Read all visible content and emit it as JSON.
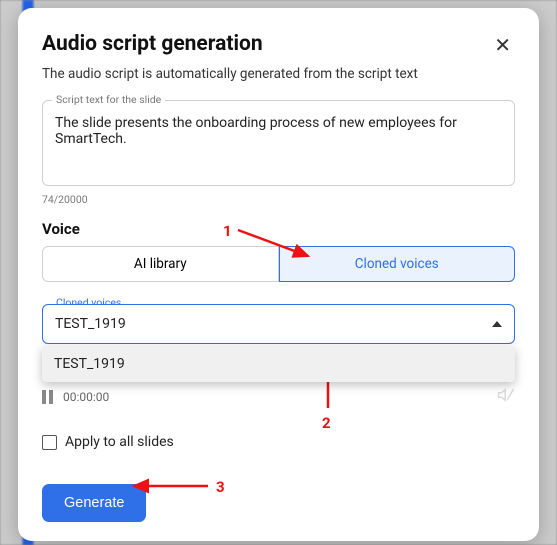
{
  "modal": {
    "title": "Audio script generation",
    "subtitle": "The audio script is automatically generated from the script text"
  },
  "script_field": {
    "label": "Script text for the slide",
    "value": "The slide presents the onboarding process of new employees for SmartTech.",
    "counter": "74/20000"
  },
  "voice": {
    "heading": "Voice",
    "tabs": {
      "ai_library": "AI library",
      "cloned": "Cloned voices",
      "active": "cloned"
    },
    "select_label": "Cloned voices",
    "selected": "TEST_1919",
    "options": [
      "TEST_1919"
    ]
  },
  "player": {
    "time": "00:00:00"
  },
  "apply_all": {
    "label": "Apply to all slides",
    "checked": false
  },
  "actions": {
    "generate": "Generate"
  },
  "annotations": {
    "n1": "1",
    "n2": "2",
    "n3": "3"
  }
}
